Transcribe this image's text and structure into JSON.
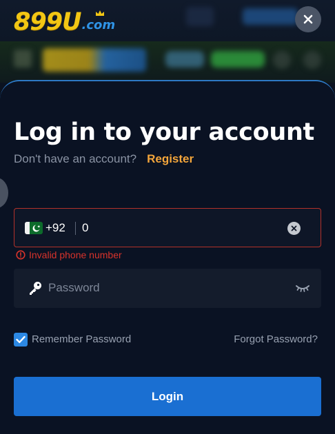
{
  "brand": {
    "name": "899U",
    "tld": ".com"
  },
  "login": {
    "title": "Log in to your account",
    "no_account_text": "Don't have an account?",
    "register_label": "Register",
    "phone": {
      "country_code": "+92",
      "value": "0",
      "error": "Invalid phone number"
    },
    "password": {
      "placeholder": "Password"
    },
    "remember_label": "Remember Password",
    "remember_checked": true,
    "forgot_label": "Forgot Password?",
    "submit_label": "Login"
  },
  "colors": {
    "accent_blue": "#1a6fd2",
    "register_orange": "#f3a53b",
    "error_red": "#d8332b",
    "brand_yellow": "#f2c614",
    "brand_blue": "#2f93e6"
  },
  "icons": {
    "close": "close-icon",
    "flag": "pakistan-flag-icon",
    "clear": "clear-x-icon",
    "error": "exclamation-circle-icon",
    "key": "key-icon",
    "eye": "eye-closed-icon",
    "check": "checkmark-icon"
  }
}
